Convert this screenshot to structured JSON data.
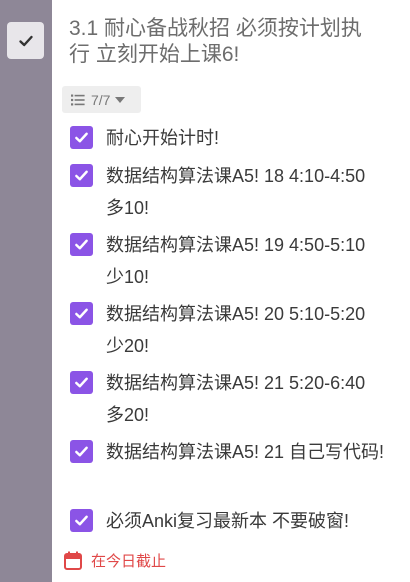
{
  "task": {
    "title": "3.1 耐心备战秋招 必须按计划执行 立刻开始上课6!",
    "completed": true
  },
  "subtasks_toggle": {
    "count": "7/7",
    "icon": "list-icon",
    "caret_icon": "caret-down-icon"
  },
  "checklist": [
    {
      "text": "耐心开始计时!",
      "checked": true
    },
    {
      "text": "数据结构算法课A5! 18 4:10-4:50 多10!",
      "checked": true
    },
    {
      "text": "数据结构算法课A5! 19 4:50-5:10 少10!",
      "checked": true
    },
    {
      "text": "数据结构算法课A5! 20 5:10-5:20 少20!",
      "checked": true
    },
    {
      "text": "数据结构算法课A5! 21 5:20-6:40 多20!",
      "checked": true
    },
    {
      "text": "数据结构算法课A5! 21 自己写代码!",
      "checked": true
    },
    {
      "text": "必须Anki复习最新本 不要破窗!",
      "checked": true
    }
  ],
  "due": {
    "label": "在今日截止",
    "icon": "calendar-icon"
  },
  "colors": {
    "sidebar": "#8e8797",
    "checkbox": "#8b54e6",
    "due": "#e04848",
    "title": "#6d6d6d"
  }
}
